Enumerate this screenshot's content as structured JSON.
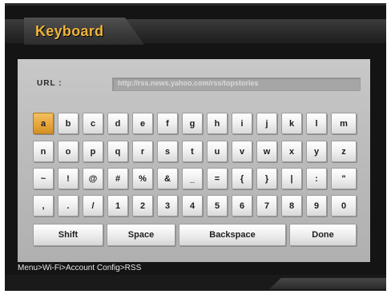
{
  "screen": {
    "title": "Keyboard",
    "breadcrumb": "Menu>Wi-Fi>Account Config>RSS",
    "accent_color": "#e8a53b"
  },
  "url": {
    "label": "URL  :",
    "value": "http://rss.news.yahoo.com/rss/topstories"
  },
  "keyboard": {
    "row1": [
      "a",
      "b",
      "c",
      "d",
      "e",
      "f",
      "g",
      "h",
      "i",
      "j",
      "k",
      "l",
      "m"
    ],
    "row2": [
      "n",
      "o",
      "p",
      "q",
      "r",
      "s",
      "t",
      "u",
      "v",
      "w",
      "x",
      "y",
      "z"
    ],
    "row3": [
      "~",
      "!",
      "@",
      "#",
      "%",
      "&",
      "_",
      "=",
      "{",
      "}",
      "|",
      ":",
      "\""
    ],
    "row4": [
      ",",
      ".",
      "/",
      "1",
      "2",
      "3",
      "4",
      "5",
      "6",
      "7",
      "8",
      "9",
      "0"
    ],
    "selected_key": "a",
    "shift_label": "Shift",
    "space_label": "Space",
    "backspace_label": "Backspace",
    "done_label": "Done"
  }
}
